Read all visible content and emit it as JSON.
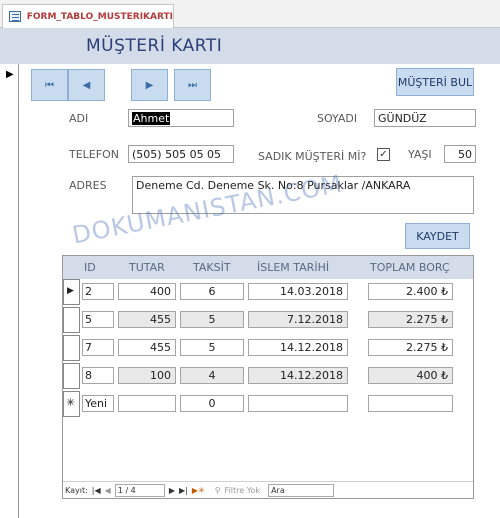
{
  "tab": {
    "label": "FORM_TABLO_MUSTERIKARTI"
  },
  "form": {
    "title": "MÜŞTERİ KARTI"
  },
  "nav": {
    "first": "⏮",
    "prev": "◀",
    "next": "▶",
    "last": "⏭"
  },
  "buttons": {
    "musteri_bul": "MÜŞTERİ BUL",
    "kaydet": "KAYDET"
  },
  "fields": {
    "adi_label": "ADI",
    "adi_value": "Ahmet",
    "soyadi_label": "SOYADI",
    "soyadi_value": "GÜNDÜZ",
    "telefon_label": "TELEFON",
    "telefon_value": "(505) 505 05 05",
    "sadik_label": "SADIK MÜŞTERİ Mİ?",
    "sadik_checked": true,
    "sadik_mark": "✓",
    "yasi_label": "YAŞI",
    "yasi_value": "50",
    "adres_label": "ADRES",
    "adres_value": "Deneme Cd. Deneme Sk. No:8 Pursaklar /ANKARA"
  },
  "watermark": "DOKUMANISTAN.COM",
  "subform": {
    "columns": [
      "ID",
      "TUTAR",
      "TAKSİT",
      "İSLEM TARİHİ",
      "TOPLAM BORÇ"
    ],
    "rows": [
      {
        "id": "2",
        "tutar": "400",
        "taksit": "6",
        "tarih": "14.03.2018",
        "borc": "2.400 ₺"
      },
      {
        "id": "5",
        "tutar": "455",
        "taksit": "5",
        "tarih": "7.12.2018",
        "borc": "2.275 ₺"
      },
      {
        "id": "7",
        "tutar": "455",
        "taksit": "5",
        "tarih": "14.12.2018",
        "borc": "2.275 ₺"
      },
      {
        "id": "8",
        "tutar": "100",
        "taksit": "4",
        "tarih": "14.12.2018",
        "borc": "400 ₺"
      }
    ],
    "new_row": {
      "id": "Yeni",
      "taksit": "0"
    }
  },
  "navbar": {
    "kayit_label": "Kayıt:",
    "position": "1 / 4",
    "filter_label": "Filtre Yok",
    "search_placeholder": "Ara"
  }
}
